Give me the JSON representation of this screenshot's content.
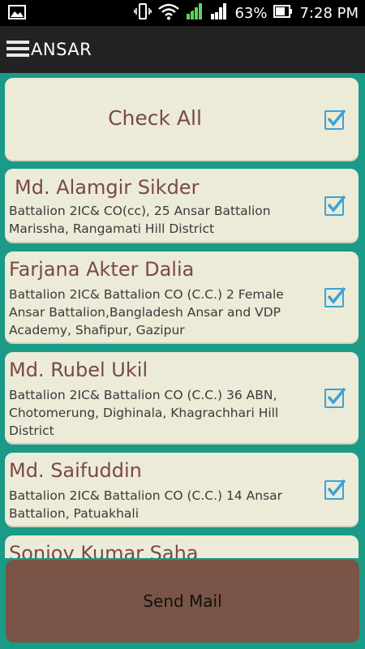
{
  "status_bar": {
    "battery_percent": "63%",
    "time": "7:28 PM",
    "sim2_label": "2"
  },
  "app_bar": {
    "title": "ANSAR"
  },
  "check_all": {
    "label": "Check All",
    "checked": true
  },
  "officers": [
    {
      "name": "Md. Alamgir Sikder",
      "description": "Battalion 2IC& CO(cc), 25 Ansar Battalion Marissha, Rangamati Hill District",
      "checked": true
    },
    {
      "name": "Farjana Akter Dalia",
      "description": "Battalion 2IC& Battalion CO (C.C.) 2 Female Ansar Battalion,Bangladesh Ansar and VDP Academy, Shafipur, Gazipur",
      "checked": true
    },
    {
      "name": "Md. Rubel Ukil",
      "description": "Battalion 2IC& Battalion CO (C.C.) 36 ABN, Chotomerung, Dighinala, Khagrachhari Hill District",
      "checked": true
    },
    {
      "name": "Md. Saifuddin",
      "description": "Battalion 2IC& Battalion CO (C.C.) 14 Ansar Battalion, Patuakhali",
      "checked": true
    },
    {
      "name": "Sonjoy Kumar Saha",
      "description": "",
      "checked": true
    }
  ],
  "send_button": {
    "label": "Send Mail"
  },
  "colors": {
    "background": "#1a9a87",
    "card": "#ecebd8",
    "accent_text": "#7a4a42",
    "checkbox": "#3aa3d8",
    "send_button": "#7a5446"
  }
}
